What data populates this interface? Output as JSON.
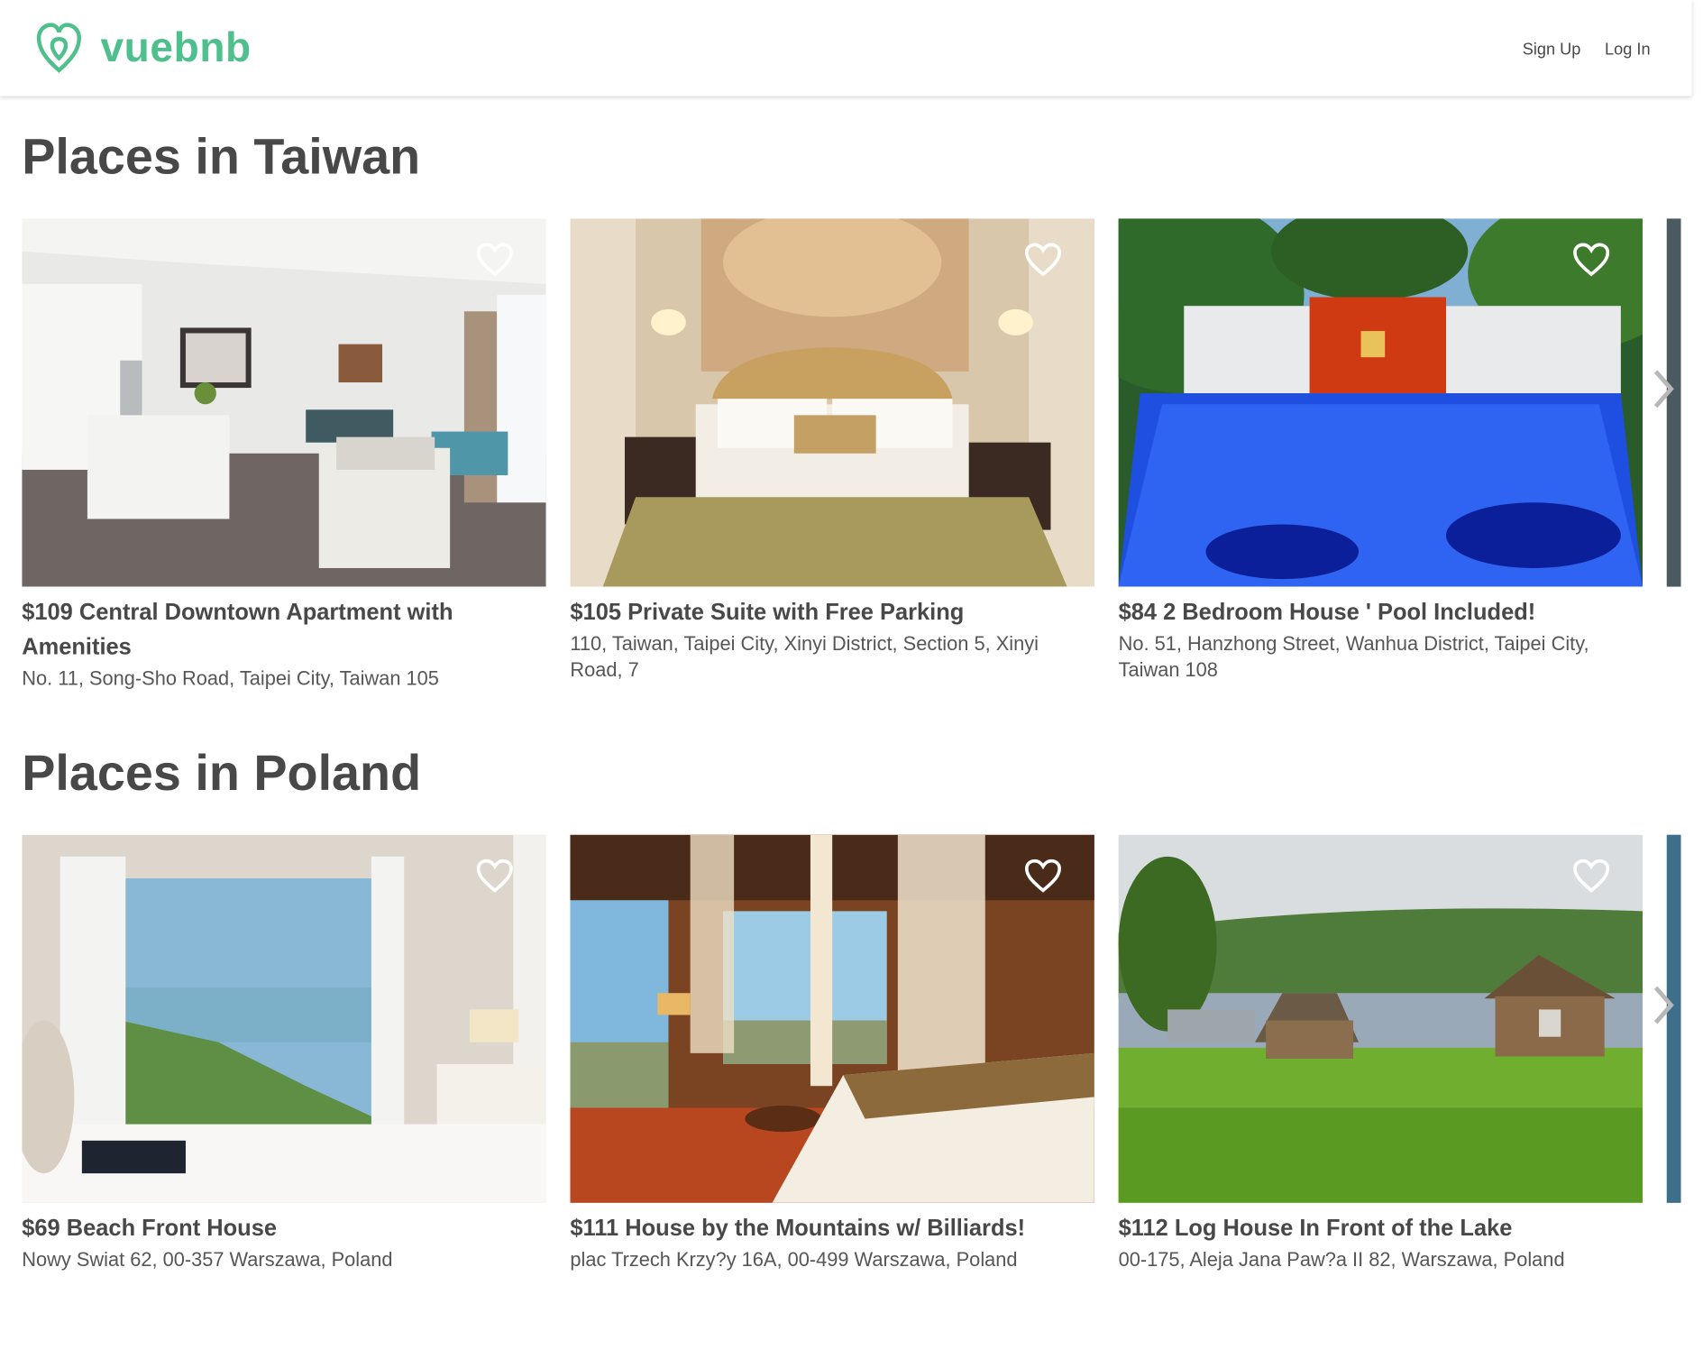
{
  "brand": {
    "name": "vuebnb",
    "logo_icon": "vuebnb-logo-icon",
    "color": "#4fc08d"
  },
  "nav": {
    "signup": "Sign Up",
    "login": "Log In"
  },
  "sections": [
    {
      "heading": "Places in Taiwan",
      "listings": [
        {
          "title": "$109 Central Downtown Apartment with Amenities",
          "address": "No. 11, Song-Sho Road, Taipei City, Taiwan 105",
          "image": "living-room"
        },
        {
          "title": "$105 Private Suite with Free Parking",
          "address": "110, Taiwan, Taipei City, Xinyi District, Section 5, Xinyi Road, 7",
          "image": "hotel-bedroom"
        },
        {
          "title": "$84 2 Bedroom House ' Pool Included!",
          "address": "No. 51, Hanzhong Street, Wanhua District, Taipei City, Taiwan 108",
          "image": "blue-pool"
        }
      ]
    },
    {
      "heading": "Places in Poland",
      "listings": [
        {
          "title": "$69 Beach Front House",
          "address": "Nowy Swiat 62, 00-357 Warszawa, Poland",
          "image": "seaview-bedroom"
        },
        {
          "title": "$111 House by the Mountains w/ Billiards!",
          "address": "plac Trzech Krzy?y 16A, 00-499 Warszawa, Poland",
          "image": "canopy-bedroom"
        },
        {
          "title": "$112 Log House In Front of the Lake",
          "address": "00-175, Aleja Jana Paw?a II 82, Warszawa, Poland",
          "image": "lake-cabins"
        }
      ]
    }
  ]
}
